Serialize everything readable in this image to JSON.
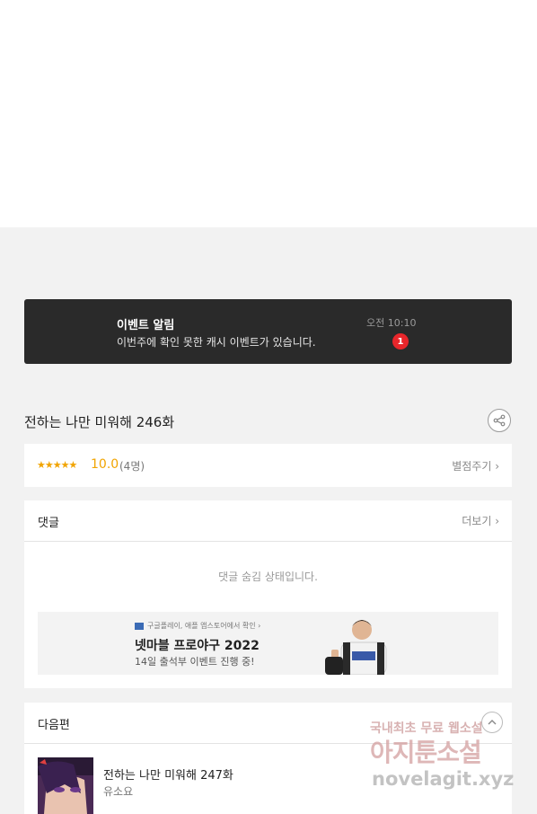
{
  "notice": {
    "title": "이벤트 알림",
    "description": "이번주에 확인 못한 캐시 이벤트가 있습니다.",
    "time": "오전 10:10",
    "badge": "1"
  },
  "episode": {
    "title": "전하는 나만 미워해 246화"
  },
  "rating": {
    "stars": "★★★★★",
    "score": "10.0",
    "count": "(4명)",
    "rate_link": "별점주기 ›"
  },
  "comments": {
    "title": "댓글",
    "more": "더보기 ›",
    "hidden_message": "댓글 숨김 상태입니다."
  },
  "ad": {
    "small_text": "구글플레이, 애플 앱스토어에서 확인 ›",
    "title": "넷마블 프로야구 2022",
    "description": "14일 출석부 이벤트 진행 중!"
  },
  "next": {
    "heading": "다음편",
    "item_title": "전하는 나만 미워해 247화",
    "item_author": "유소요"
  },
  "watermark": {
    "line1": "국내최초 무료 웹소설",
    "line2": "아지툰소설",
    "line3": "novelagit.xyz"
  },
  "colors": {
    "accent_star": "#f1a400",
    "badge_red": "#e8262b",
    "notice_bg": "#2a2a2a"
  }
}
